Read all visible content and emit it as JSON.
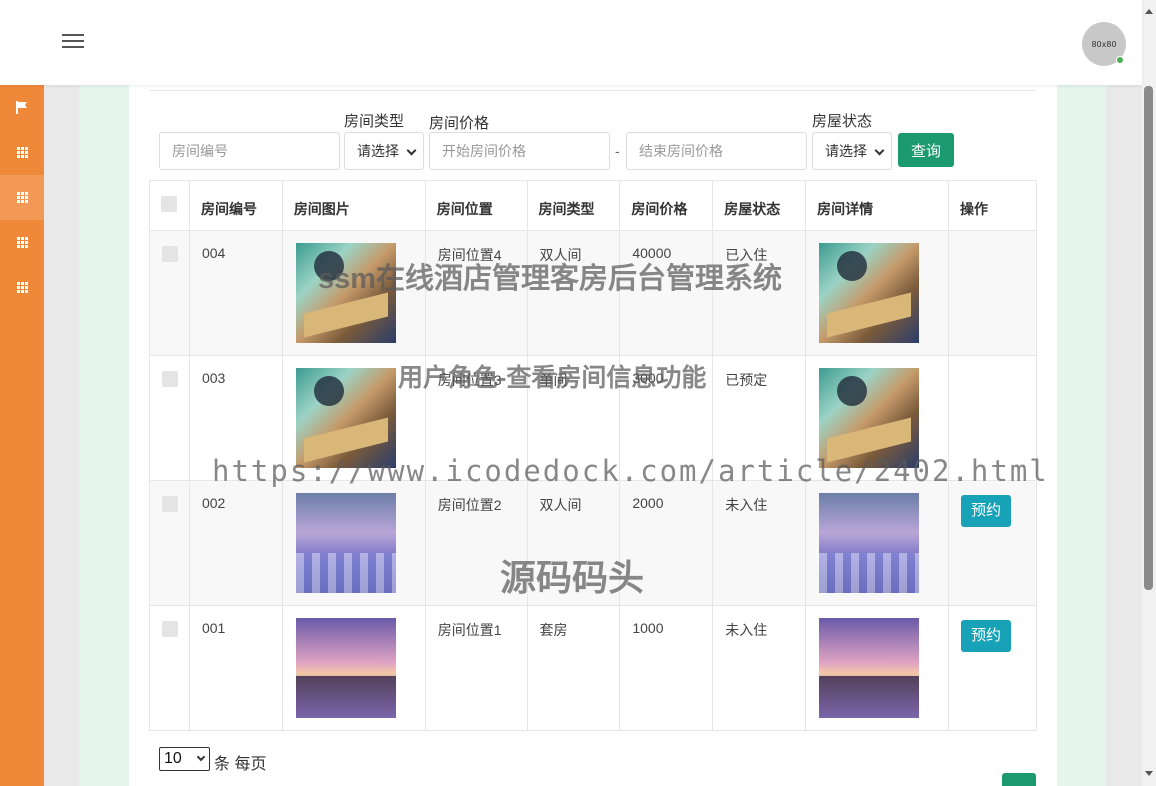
{
  "header": {
    "avatar_text": "80x80"
  },
  "sidebar": {
    "items": [
      {
        "icon": "flag-icon"
      },
      {
        "icon": "grid-icon"
      },
      {
        "icon": "grid-icon"
      },
      {
        "icon": "grid-icon"
      },
      {
        "icon": "grid-icon"
      }
    ]
  },
  "filters": {
    "room_number_placeholder": "房间编号",
    "room_type_label": "房间类型",
    "room_type_value": "请选择",
    "room_price_label": "房间价格",
    "price_start_placeholder": "开始房间价格",
    "price_separator": "-",
    "price_end_placeholder": "结束房间价格",
    "room_status_label": "房屋状态",
    "room_status_value": "请选择",
    "search_button": "查询"
  },
  "table": {
    "columns": [
      "房间编号",
      "房间图片",
      "房间位置",
      "房间类型",
      "房间价格",
      "房屋状态",
      "房间详情",
      "操作"
    ],
    "rows": [
      {
        "number": "004",
        "image": "room",
        "location": "房间位置4",
        "type": "双人间",
        "price": "40000",
        "status": "已入住",
        "detail_image": "room",
        "action": ""
      },
      {
        "number": "003",
        "image": "room",
        "location": "房间位置3",
        "type": "单间",
        "price": "3000",
        "status": "已预定",
        "detail_image": "room",
        "action": ""
      },
      {
        "number": "002",
        "image": "pool",
        "location": "房间位置2",
        "type": "双人间",
        "price": "2000",
        "status": "未入住",
        "detail_image": "pool",
        "action": "预约"
      },
      {
        "number": "001",
        "image": "sunset",
        "location": "房间位置1",
        "type": "套房",
        "price": "1000",
        "status": "未入住",
        "detail_image": "sunset",
        "action": "预约"
      }
    ]
  },
  "pagination": {
    "page_size": "10",
    "per_page_text": "条 每页"
  },
  "watermarks": {
    "line1": "ssm在线酒店管理客房后台管理系统",
    "line2": "用户角色-查看房间信息功能",
    "line3": "https://www.icodedock.com/article/2402.html",
    "line4": "源码码头"
  }
}
